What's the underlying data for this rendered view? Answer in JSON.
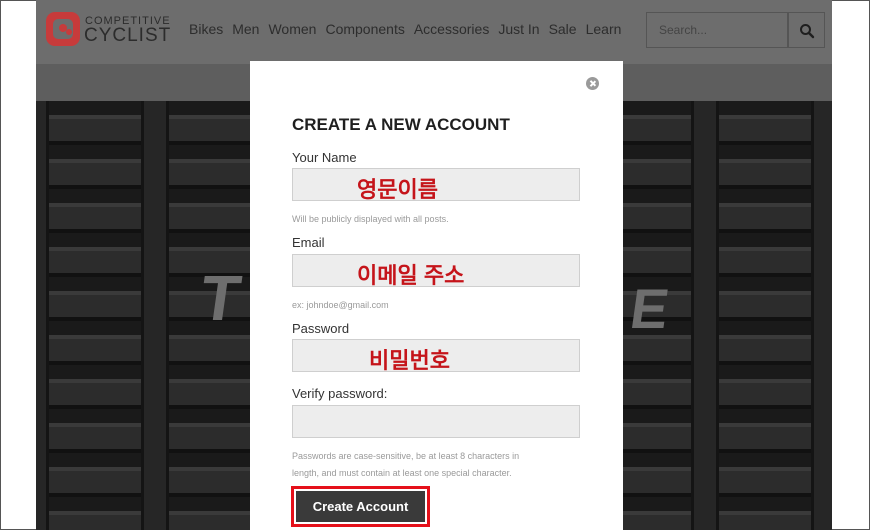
{
  "logo": {
    "line1": "COMPETITIVE",
    "line2": "CYCLIST"
  },
  "nav": [
    "Bikes",
    "Men",
    "Women",
    "Components",
    "Accessories",
    "Just In",
    "Sale",
    "Learn"
  ],
  "search": {
    "placeholder": "Search..."
  },
  "hero": {
    "left_text": "T",
    "right_text": "E"
  },
  "modal": {
    "title": "CREATE A NEW ACCOUNT",
    "name_label": "Your Name",
    "name_annotation": "영문이름",
    "name_help": "Will be publicly displayed with all posts.",
    "email_label": "Email",
    "email_annotation": "이메일 주소",
    "email_help": "ex: johndoe@gmail.com",
    "password_label": "Password",
    "password_annotation": "비밀번호",
    "verify_label": "Verify password:",
    "password_help_line1": "Passwords are case-sensitive, be at least 8 characters in",
    "password_help_line2": "length, and must contain at least one special character.",
    "submit_label": "Create Account"
  },
  "colors": {
    "annotation_red": "#c5141a",
    "highlight_border": "#e5101a",
    "logo_red": "#c73b3b"
  }
}
